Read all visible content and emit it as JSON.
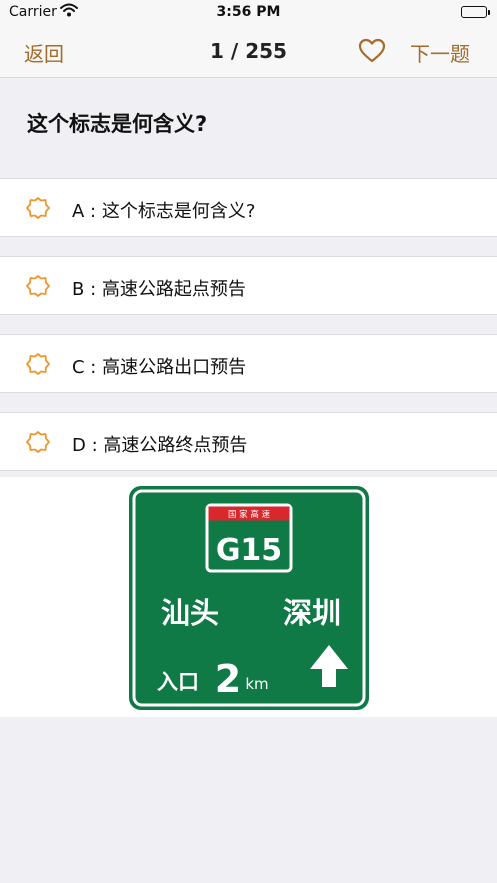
{
  "status_bar": {
    "carrier": "Carrier",
    "time": "3:56 PM"
  },
  "nav": {
    "back_label": "返回",
    "progress": "1 / 255",
    "favorite_icon": "heart-outline-icon",
    "next_label": "下一题",
    "accent_color": "#a46b2a"
  },
  "question": {
    "text": "这个标志是何含义?"
  },
  "options": [
    {
      "label": "A : 这个标志是何含义?"
    },
    {
      "label": "B : 高速公路起点预告"
    },
    {
      "label": "C : 高速公路出口预告"
    },
    {
      "label": "D : 高速公路终点预告"
    }
  ],
  "option_icon_color": "#f0962c",
  "sign": {
    "background_color": "#0f7a46",
    "badge_text": "国 家 高 速",
    "route": "G15",
    "dest_left": "汕头",
    "dest_right": "深圳",
    "entrance_label": "入口",
    "distance_value": "2",
    "distance_unit": "km"
  }
}
